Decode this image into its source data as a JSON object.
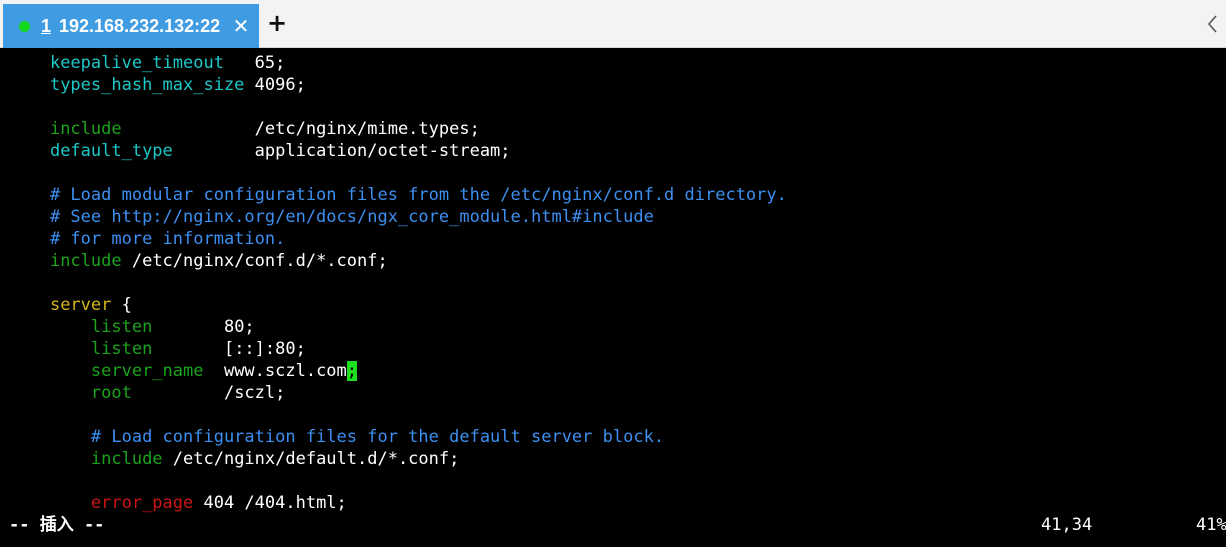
{
  "tab": {
    "number": "1",
    "title": "192.168.232.132:22",
    "close_glyph": "✕",
    "status_color": "#14d81c"
  },
  "new_tab_glyph": "+",
  "scroll_icon": "chevron-left-icon",
  "lines": [
    {
      "parts": [
        {
          "text": "    ",
          "cls": "c-white"
        },
        {
          "text": "keepalive_timeout",
          "cls": "c-cyan"
        },
        {
          "text": "   65;",
          "cls": "c-white"
        }
      ]
    },
    {
      "parts": [
        {
          "text": "    ",
          "cls": "c-white"
        },
        {
          "text": "types_hash_max_size",
          "cls": "c-cyan"
        },
        {
          "text": " 4096;",
          "cls": "c-white"
        }
      ]
    },
    {
      "parts": []
    },
    {
      "parts": [
        {
          "text": "    ",
          "cls": "c-white"
        },
        {
          "text": "include",
          "cls": "c-green"
        },
        {
          "text": "             /etc/nginx/mime.types;",
          "cls": "c-white"
        }
      ]
    },
    {
      "parts": [
        {
          "text": "    ",
          "cls": "c-white"
        },
        {
          "text": "default_type",
          "cls": "c-cyan"
        },
        {
          "text": "        application/octet-stream;",
          "cls": "c-white"
        }
      ]
    },
    {
      "parts": []
    },
    {
      "parts": [
        {
          "text": "    ",
          "cls": "c-white"
        },
        {
          "text": "# Load modular configuration files from the /etc/nginx/conf.d directory.",
          "cls": "c-comment"
        }
      ]
    },
    {
      "parts": [
        {
          "text": "    ",
          "cls": "c-white"
        },
        {
          "text": "# See http://nginx.org/en/docs/ngx_core_module.html#include",
          "cls": "c-comment"
        }
      ]
    },
    {
      "parts": [
        {
          "text": "    ",
          "cls": "c-white"
        },
        {
          "text": "# for more information.",
          "cls": "c-comment"
        }
      ]
    },
    {
      "parts": [
        {
          "text": "    ",
          "cls": "c-white"
        },
        {
          "text": "include",
          "cls": "c-green"
        },
        {
          "text": " /etc/nginx/conf.d/*.conf;",
          "cls": "c-white"
        }
      ]
    },
    {
      "parts": []
    },
    {
      "parts": [
        {
          "text": "    ",
          "cls": "c-white"
        },
        {
          "text": "server",
          "cls": "c-yellow"
        },
        {
          "text": " {",
          "cls": "c-white"
        }
      ]
    },
    {
      "parts": [
        {
          "text": "        ",
          "cls": "c-white"
        },
        {
          "text": "listen",
          "cls": "c-green"
        },
        {
          "text": "       80;",
          "cls": "c-white"
        }
      ]
    },
    {
      "parts": [
        {
          "text": "        ",
          "cls": "c-white"
        },
        {
          "text": "listen",
          "cls": "c-green"
        },
        {
          "text": "       [::]:80;",
          "cls": "c-white"
        }
      ]
    },
    {
      "parts": [
        {
          "text": "        ",
          "cls": "c-white"
        },
        {
          "text": "server_name",
          "cls": "c-green"
        },
        {
          "text": "  www.sczl.com",
          "cls": "c-white"
        },
        {
          "text": ";",
          "cls": "cursor"
        }
      ]
    },
    {
      "parts": [
        {
          "text": "        ",
          "cls": "c-white"
        },
        {
          "text": "root",
          "cls": "c-green"
        },
        {
          "text": "         /sczl;",
          "cls": "c-white"
        }
      ]
    },
    {
      "parts": []
    },
    {
      "parts": [
        {
          "text": "        ",
          "cls": "c-white"
        },
        {
          "text": "# Load configuration files for the default server block.",
          "cls": "c-comment"
        }
      ]
    },
    {
      "parts": [
        {
          "text": "        ",
          "cls": "c-white"
        },
        {
          "text": "include",
          "cls": "c-green"
        },
        {
          "text": " /etc/nginx/default.d/*.conf;",
          "cls": "c-white"
        }
      ]
    },
    {
      "parts": []
    },
    {
      "parts": [
        {
          "text": "        ",
          "cls": "c-white"
        },
        {
          "text": "error_page",
          "cls": "c-red"
        },
        {
          "text": " 404 /404.html;",
          "cls": "c-white"
        }
      ]
    }
  ],
  "status": {
    "mode": "-- 插入 --",
    "position": "41,34",
    "percent": "41%"
  }
}
